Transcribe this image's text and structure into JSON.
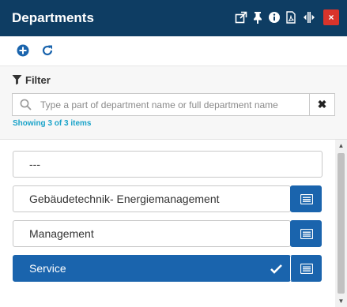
{
  "panel": {
    "title": "Departments"
  },
  "title_icons": [
    "external-link-icon",
    "pin-icon",
    "info-icon",
    "pdf-icon",
    "resize-icon"
  ],
  "close_label": "×",
  "toolbar": {
    "icons": [
      "add-icon",
      "refresh-icon"
    ]
  },
  "filter": {
    "label": "Filter",
    "placeholder": "Type a part of department name or full department name",
    "value": "",
    "clear_label": "✖",
    "showing": "Showing 3 of 3 items"
  },
  "departments": [
    {
      "name": "---",
      "has_action": false,
      "selected": false
    },
    {
      "name": "Gebäudetechnik- Energiemanagement",
      "has_action": true,
      "selected": false
    },
    {
      "name": "Management",
      "has_action": true,
      "selected": false
    },
    {
      "name": "Service",
      "has_action": true,
      "selected": true
    }
  ],
  "colors": {
    "titlebar": "#0e3d63",
    "accent": "#1a64ad",
    "close": "#d9342b",
    "link": "#1aa3c9"
  }
}
